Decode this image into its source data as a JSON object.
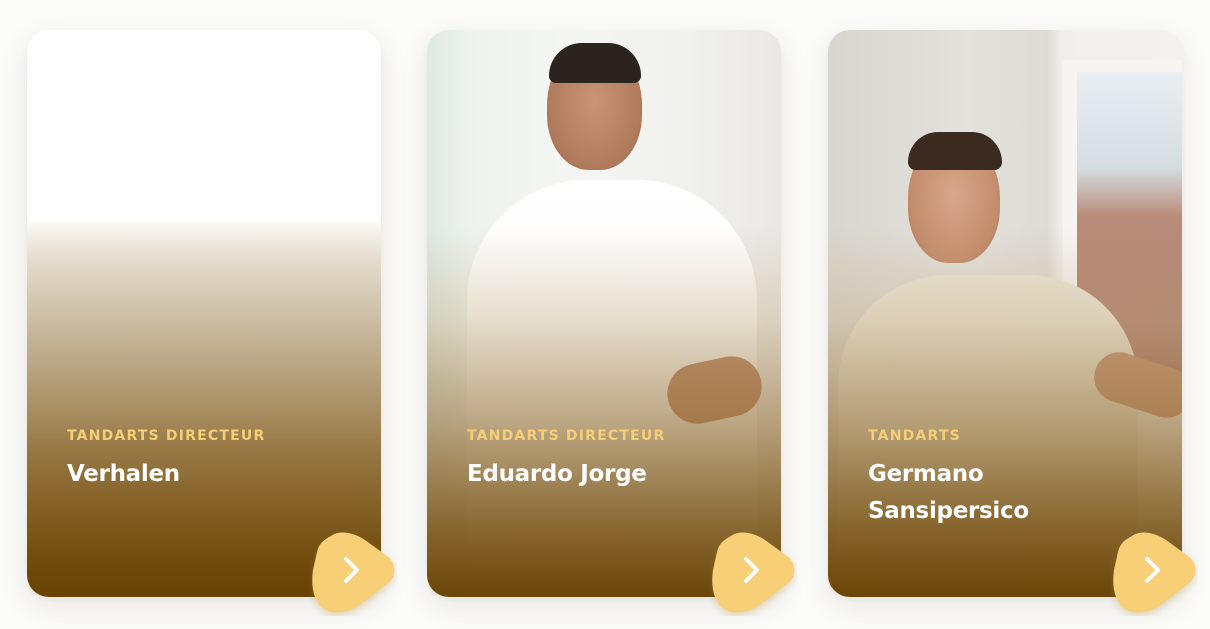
{
  "cards": [
    {
      "role": "TANDARTS DIRECTEUR",
      "name_lines": [
        "Verhalen"
      ],
      "link_icon": "chevron-right-icon"
    },
    {
      "role": "TANDARTS DIRECTEUR",
      "name_lines": [
        "Eduardo Jorge"
      ],
      "link_icon": "chevron-right-icon"
    },
    {
      "role": "TANDARTS",
      "name_lines": [
        "Germano",
        "Sansipersico"
      ],
      "link_icon": "chevron-right-icon"
    }
  ],
  "colors": {
    "role_text": "#f5cf77",
    "name_text": "#ffffff",
    "gradient_bottom": "#684204",
    "button_fill": "#f6cf77",
    "button_icon": "#ffffff"
  }
}
